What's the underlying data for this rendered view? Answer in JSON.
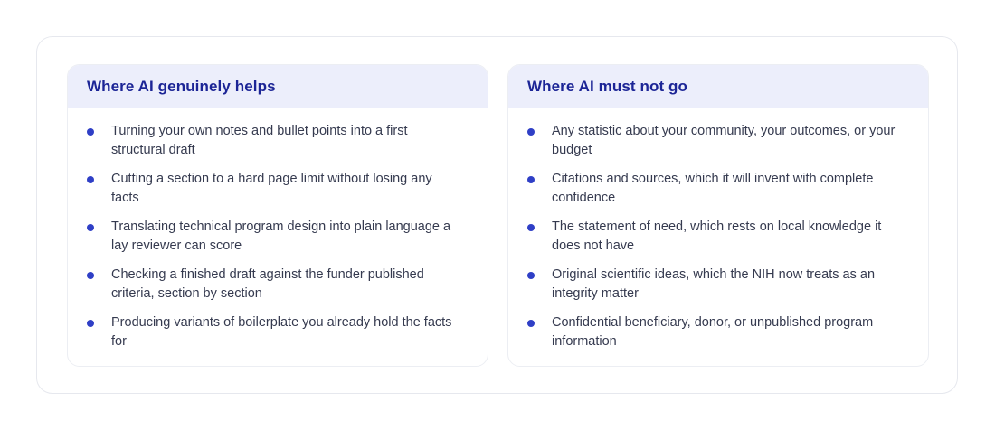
{
  "left_card": {
    "title": "Where AI genuinely helps",
    "items": [
      "Turning your own notes and bullet points into a first structural draft",
      "Cutting a section to a hard page limit without losing any facts",
      "Translating technical program design into plain language a lay reviewer can score",
      "Checking a finished draft against the funder published criteria, section by section",
      "Producing variants of boilerplate you already hold the facts for"
    ]
  },
  "right_card": {
    "title": "Where AI must not go",
    "items": [
      "Any statistic about your community, your outcomes, or your budget",
      "Citations and sources, which it will invent with complete confidence",
      "The statement of need, which rests on local knowledge it does not have",
      "Original scientific ideas, which the NIH now treats as an integrity matter",
      "Confidential beneficiary, donor, or unpublished program information"
    ]
  },
  "colors": {
    "title": "#1c2596",
    "header_bg": "#eceefb",
    "bullet": "#2f3fc6",
    "text": "#353a4f"
  }
}
